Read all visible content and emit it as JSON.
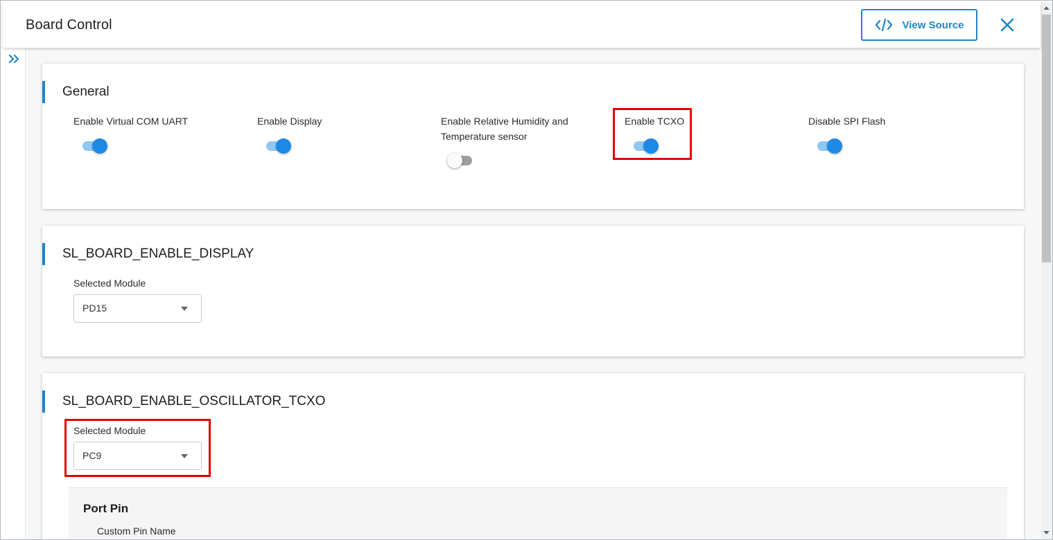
{
  "header": {
    "title": "Board Control",
    "view_source_label": "View Source",
    "view_source_icon": "code-icon",
    "close_icon": "close-icon",
    "accent_color": "#1d86c9"
  },
  "sidebar": {
    "expand_icon": "double-chevron-right-icon"
  },
  "general": {
    "title": "General",
    "toggles": [
      {
        "label": "Enable Virtual COM UART",
        "state": "on"
      },
      {
        "label": "Enable Display",
        "state": "on"
      },
      {
        "label_line1": "Enable Relative Humidity and",
        "label_line2": "Temperature sensor",
        "state": "off"
      },
      {
        "label": "Enable TCXO",
        "state": "on"
      },
      {
        "label": "Disable SPI Flash",
        "state": "on"
      }
    ]
  },
  "display_section": {
    "title": "SL_BOARD_ENABLE_DISPLAY",
    "selected_module_label": "Selected Module",
    "selected_module_value": "PD15"
  },
  "tcxo_section": {
    "title": "SL_BOARD_ENABLE_OSCILLATOR_TCXO",
    "selected_module_label": "Selected Module",
    "selected_module_value": "PC9",
    "port_pin": {
      "title": "Port Pin",
      "custom_pin_name_label": "Custom Pin Name"
    }
  },
  "highlight_color": "#e00000"
}
